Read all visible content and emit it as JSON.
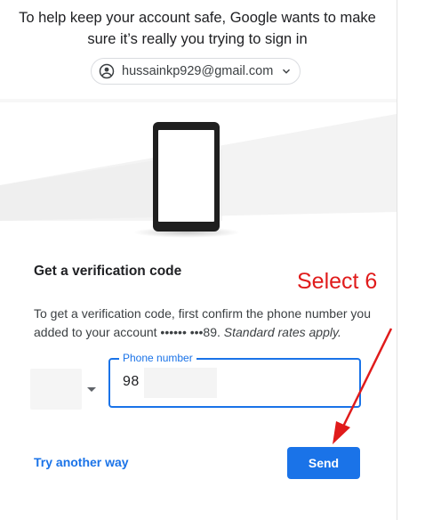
{
  "intro": {
    "text": "To help keep your account safe, Google wants to make sure it’s really you trying to sign in"
  },
  "account": {
    "email": "hussainkp929@gmail.com"
  },
  "verification": {
    "title": "Get a verification code",
    "description_main": "To get a verification code, first confirm the phone number you added to your account •••••• •••89.",
    "description_note": "Standard rates apply."
  },
  "phone": {
    "label": "Phone number",
    "visible_value": "98"
  },
  "actions": {
    "try_another": "Try another way",
    "send": "Send"
  },
  "annotation": {
    "text": "Select 6",
    "color": "#e01b1b"
  },
  "colors": {
    "accent": "#1a73e8",
    "text": "#202124",
    "secondary_text": "#3c4043"
  },
  "icons": {
    "account": "account-circle-icon",
    "chevron": "chevron-down-icon",
    "phone": "phone-illustration",
    "arrow": "red-arrow-annotation"
  }
}
